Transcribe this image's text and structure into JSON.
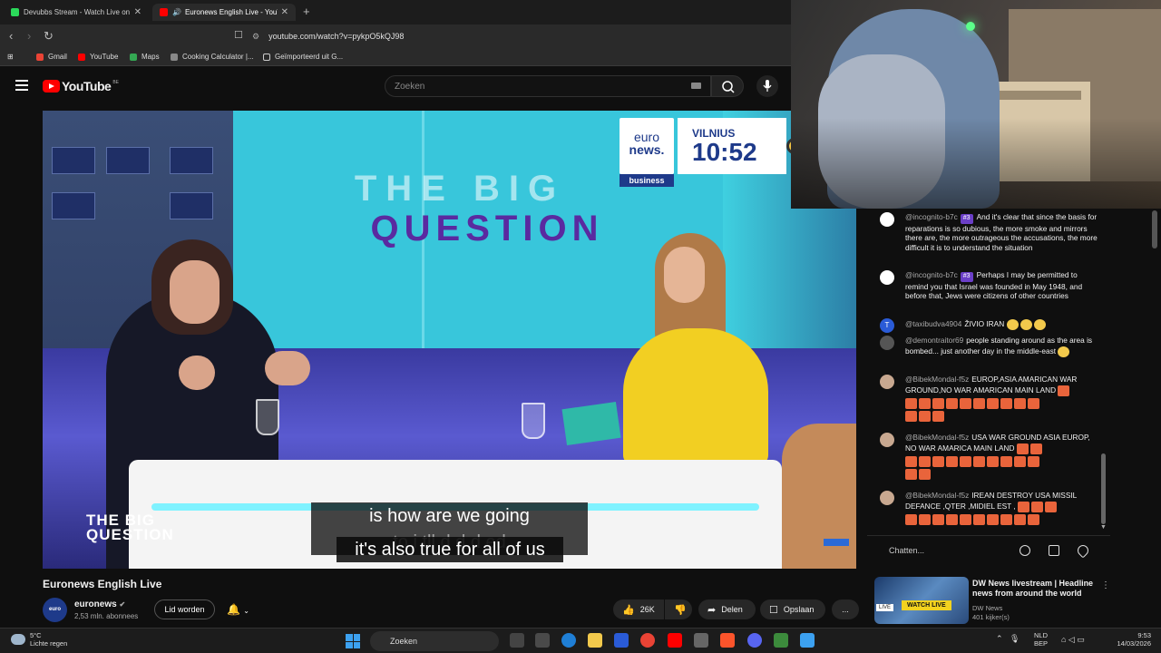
{
  "browser": {
    "tabs": [
      {
        "title": "Devubbs Stream - Watch Live on",
        "favicon_color": "#2bd95a"
      },
      {
        "title": "Euronews English Live - YouTube",
        "favicon_color": "#ff0000"
      }
    ],
    "url": "youtube.com/watch?v=pykpO5kQJ98",
    "bookmarks": [
      "Gmail",
      "YouTube",
      "Maps",
      "Cooking Calculator |...",
      "Geïmporteerd uit G..."
    ]
  },
  "youtube": {
    "logo": "YouTube",
    "logo_country": "BE",
    "search_placeholder": "Zoeken"
  },
  "video": {
    "title": "Euronews English Live",
    "big_question_line1": "THE BIG",
    "big_question_line2": "QUESTION",
    "logo_line1": "euro",
    "logo_line2": "news.",
    "logo_section": "business",
    "city": "VILNIUS",
    "time": "10:52",
    "lower_third_line1": "THE BIG",
    "lower_third_line2": "QUESTION",
    "subtitle_line1": "is how are we going",
    "subtitle_line2_faded": "to i   tll   d  d    d   ed",
    "subtitle_line3": "it's also true for all of us"
  },
  "channel": {
    "name": "euronews",
    "avatar_text": "euro news.",
    "subscribers": "2,53 mln. abonnees",
    "join_label": "Lid worden"
  },
  "actions": {
    "likes": "26K",
    "share": "Delen",
    "save": "Opslaan",
    "more": "..."
  },
  "chat": {
    "messages": [
      {
        "author": "@incognito-b7c",
        "badge": "#3",
        "text": "And it's clear that since the basis for reparations is so dubious, the more smoke and mirrors there are, the more outrageous the accusations, the more difficult it is to understand the situation",
        "avatar_color": "#ffffff"
      },
      {
        "author": "@incognito-b7c",
        "badge": "#3",
        "text": "Perhaps I may be permitted to remind you that Israel was founded in May 1948, and before that, Jews were citizens of other countries",
        "avatar_color": "#ffffff"
      },
      {
        "author": "@taxibudva4904",
        "badge": "",
        "text": "ŽIVIO IRAN",
        "avatar_color": "#2a5bd7",
        "avatar_letter": "T"
      },
      {
        "author": "@demontraitor69",
        "badge": "",
        "text": "people standing around as the area is bombed... just another day in the middle-east",
        "avatar_color": "#555555"
      },
      {
        "author": "@BibekMondal-f5z",
        "badge": "",
        "text": "EUROP,ASIA AMARICAN WAR GROUND,NO WAR AMARICAN MAIN LAND",
        "avatar_color": "#c8a890"
      },
      {
        "author": "@BibekMondal-f5z",
        "badge": "",
        "text": "USA WAR GROUND ASIA EUROP, NO WAR AMARICA MAIN LAND",
        "avatar_color": "#c8a890"
      },
      {
        "author": "@BibekMondal-f5z",
        "badge": "",
        "text": "IREAN DESTROY USA MISSIL DEFANCE ,QTER ,MIDIEL EST ,",
        "avatar_color": "#c8a890"
      }
    ],
    "input_placeholder": "Chatten..."
  },
  "recommendation": {
    "title": "DW News livestream | Headline news from around the world",
    "channel": "DW News",
    "viewers": "401 kijker(s)",
    "watch_live": "WATCH LIVE",
    "badge": "LIVE"
  },
  "taskbar": {
    "temperature": "5°C",
    "weather": "Lichte regen",
    "search": "Zoeken",
    "lang1": "NLD",
    "lang2": "BEP",
    "time": "9:53",
    "date": "14/03/2026"
  }
}
